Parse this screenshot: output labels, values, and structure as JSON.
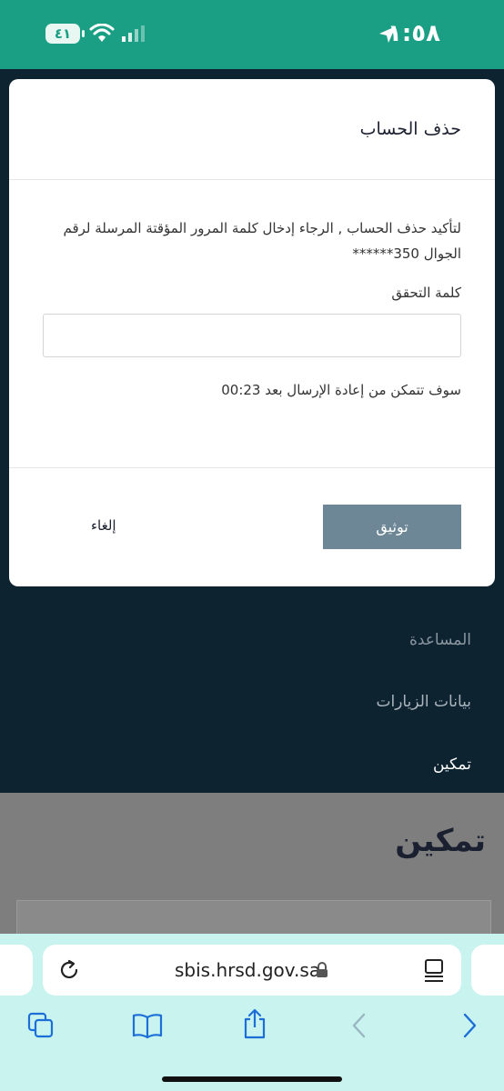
{
  "status_bar": {
    "time": "١:٥٨",
    "battery": "٤١"
  },
  "background_nav": {
    "items": [
      "المساعدة",
      "بيانات الزيارات",
      "تمكين"
    ]
  },
  "page": {
    "title": "تمكين"
  },
  "modal": {
    "title": "حذف الحساب",
    "message": "لتأكيد حذف الحساب , الرجاء إدخال كلمة المرور المؤقتة المرسلة لرقم الجوال 350******",
    "code_label": "كلمة التحقق",
    "code_value": "",
    "resend_text": "سوف تتمكن من إعادة الإرسال بعد 00:23",
    "confirm_label": "توثيق",
    "cancel_label": "إلغاء"
  },
  "browser": {
    "url": "sbis.hrsd.gov.sa"
  },
  "colors": {
    "status_bar": "#1a9f84",
    "nav_panel": "#0e2330",
    "confirm_button": "#6e8796",
    "browser_bar": "#c9f3ee"
  }
}
